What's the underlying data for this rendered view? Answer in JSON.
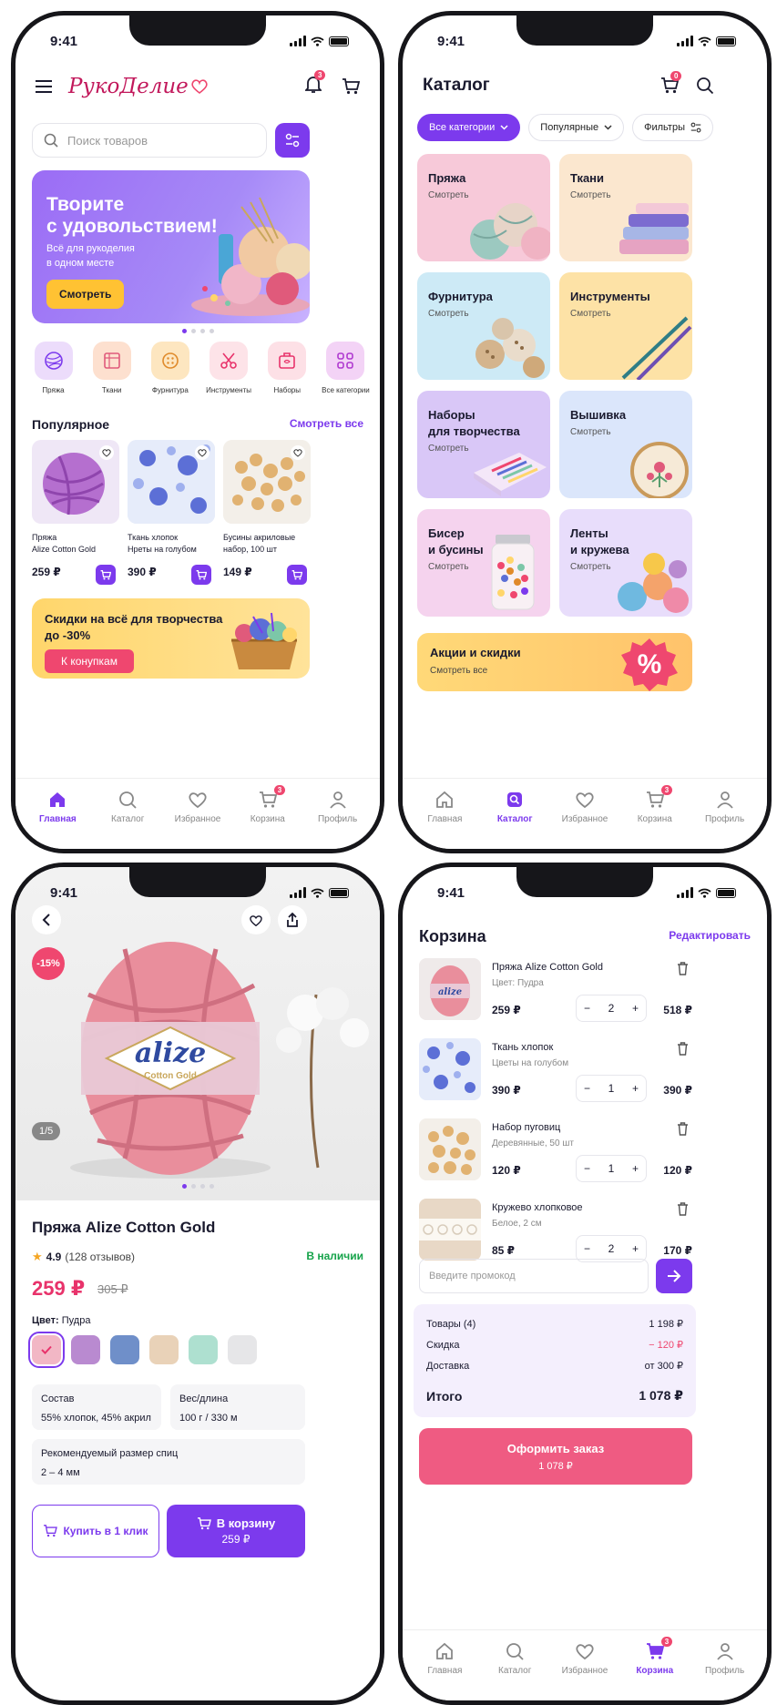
{
  "status_time": "9:41",
  "tabbar": {
    "home": "Главная",
    "catalog": "Каталог",
    "favorites": "Избранное",
    "cart": "Корзина",
    "profile": "Профиль",
    "cart_badge": "3"
  },
  "home": {
    "logo": "РукоДелие",
    "bell_badge": "3",
    "search_placeholder": "Поиск товаров",
    "banner": {
      "title_line1": "Творите",
      "title_line2": "с удовольствием!",
      "subtitle_line1": "Всё для рукоделия",
      "subtitle_line2": "в одном месте",
      "button": "Смотреть"
    },
    "categories": [
      "Пряжа",
      "Ткани",
      "Фурнитура",
      "Инструменты",
      "Наборы",
      "Все категории"
    ],
    "popular_title": "Популярное",
    "see_all": "Смотреть все",
    "products": [
      {
        "name1": "Пряжа",
        "name2": "Alize Cotton Gold",
        "price": "259 ₽"
      },
      {
        "name1": "Ткань хлопок",
        "name2": "Нреты на голубом",
        "price": "390 ₽"
      },
      {
        "name1": "Бусины акриловые",
        "name2": "набор, 100 шт",
        "price": "149 ₽"
      }
    ],
    "promo": {
      "text": "Скидки на всё для творчества до -30%",
      "button": "К конупкам"
    }
  },
  "catalog": {
    "title": "Каталог",
    "cart_badge": "0",
    "chips": [
      "Все категории",
      "Популярные",
      "Фильтры"
    ],
    "tiles": [
      {
        "title": "Пряжа",
        "sub": "Смотреть",
        "color": "#f7c9d9"
      },
      {
        "title": "Ткани",
        "sub": "Смотреть",
        "color": "#fbe7cf"
      },
      {
        "title": "Фурнитура",
        "sub": "Смотреть",
        "color": "#cdeaf6"
      },
      {
        "title": "Инструменты",
        "sub": "Смотреть",
        "color": "#fde2a6"
      },
      {
        "title": "Наборы\nдля творчества",
        "sub": "Смотреть",
        "color": "#d9c7f7"
      },
      {
        "title": "Вышивка",
        "sub": "Смотреть",
        "color": "#dbe6fb"
      },
      {
        "title": "Бисер\nи бусины",
        "sub": "Смотреть",
        "color": "#f5d3ee"
      },
      {
        "title": "Ленты\nи кружева",
        "sub": "Смотреть",
        "color": "#e8ddfb"
      }
    ],
    "sale_title": "Акции и скидки",
    "sale_sub": "Смотреть все"
  },
  "product": {
    "discount": "-15%",
    "counter": "1/5",
    "name": "Пряжа Alize Cotton Gold",
    "rating": "4.9",
    "reviews": "(128 отзывов)",
    "stock": "В наличии",
    "price": "259 ₽",
    "old_price": "305 ₽",
    "color_label": "Цвет:",
    "color_value": "Пудра",
    "swatches": [
      "#f2b7c5",
      "#b98ad0",
      "#6f8fc9",
      "#e9d2b8",
      "#aee0d0",
      "#e6e6e8"
    ],
    "spec1_label": "Состав",
    "spec1_value": "55% хлопок, 45% акрил",
    "spec2_label": "Вес/длина",
    "spec2_value": "100 г / 330 м",
    "spec3_label": "Рекомендуемый размер спиц",
    "spec3_value": "2 – 4 мм",
    "buy_one_click": "Купить в 1 клик",
    "to_cart": "В корзину",
    "to_cart_price": "259 ₽",
    "brand_label": "alize",
    "brand_sub": "Cotton Gold"
  },
  "cart": {
    "title": "Корзина",
    "edit": "Редактировать",
    "items": [
      {
        "name": "Пряжа Alize Cotton Gold",
        "sub": "Цвет: Пудра",
        "price": "259 ₽",
        "qty": "2",
        "total": "518 ₽"
      },
      {
        "name": "Ткань хлопок",
        "sub": "Цветы на голубом",
        "price": "390 ₽",
        "qty": "1",
        "total": "390 ₽"
      },
      {
        "name": "Набор пуговиц",
        "sub": "Деревянные, 50 шт",
        "price": "120 ₽",
        "qty": "1",
        "total": "120 ₽"
      },
      {
        "name": "Кружево хлопковое",
        "sub": "Белое, 2 см",
        "price": "85 ₽",
        "qty": "2",
        "total": "170 ₽"
      }
    ],
    "promo_placeholder": "Введите промокод",
    "goods_label": "Товары (4)",
    "goods_value": "1 198 ₽",
    "discount_label": "Скидка",
    "discount_value": "− 120 ₽",
    "delivery_label": "Доставка",
    "delivery_value": "от 300 ₽",
    "total_label": "Итого",
    "total_value": "1 078 ₽",
    "checkout": "Оформить заказ",
    "checkout_sum": "1 078 ₽"
  },
  "colors": {
    "accent": "#7c3aed",
    "pink": "#ef476f",
    "success": "#16a34a"
  }
}
